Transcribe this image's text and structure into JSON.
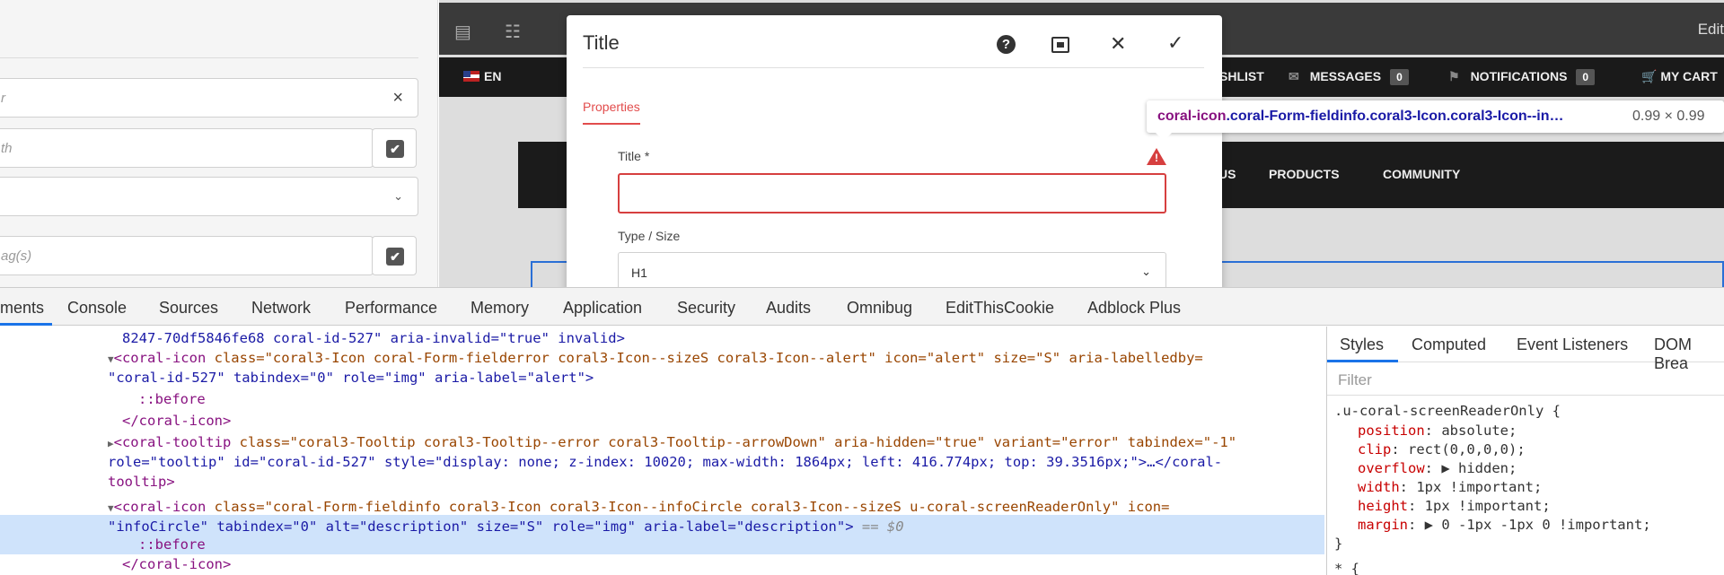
{
  "side_panel": {
    "field1_value": "r",
    "field2_placeholder": "th",
    "field4_placeholder": "ag(s)",
    "clear_symbol": "×",
    "check_symbol": "✔",
    "chevron_symbol": "⌄"
  },
  "editor": {
    "edit_label": "Edit"
  },
  "site_nav": {
    "language": "EN",
    "wishlist": "SHLIST",
    "messages": "MESSAGES",
    "messages_count": "0",
    "notifications": "NOTIFICATIONS",
    "notifications_count": "0",
    "cart": "MY CART"
  },
  "site_menu": {
    "items": [
      "US",
      "PRODUCTS",
      "COMMUNITY"
    ]
  },
  "dialog": {
    "title": "Title",
    "help_glyph": "?",
    "close_glyph": "✕",
    "confirm_glyph": "✓",
    "tab_properties": "Properties",
    "field_title_label": "Title *",
    "field_title_value": "",
    "alert_glyph": "!",
    "field_type_label": "Type / Size",
    "field_type_value": "H1",
    "chevron": "⌄"
  },
  "inspect_tooltip": {
    "tag": "coral-icon",
    "classes": ".coral-Form-fieldinfo.coral3-Icon.coral3-Icon--in…",
    "dimensions": "0.99 × 0.99"
  },
  "devtools": {
    "tabs": [
      "ments",
      "Console",
      "Sources",
      "Network",
      "Performance",
      "Memory",
      "Application",
      "Security",
      "Audits",
      "Omnibug",
      "EditThisCookie",
      "Adblock Plus"
    ],
    "active_tab": "ments",
    "styles_tabs": [
      "Styles",
      "Computed",
      "Event Listeners",
      "DOM Brea"
    ],
    "filter_placeholder": "Filter",
    "dom": {
      "l1": "8247-70df5846fe68 coral-id-527\" aria-invalid=\"true\" invalid>",
      "l2_tag": "<coral-icon",
      "l2_attrs": " class=\"coral3-Icon coral-Form-fielderror coral3-Icon--sizeS coral3-Icon--alert\" icon=\"alert\" size=\"S\" aria-labelledby=",
      "l3": "\"coral-id-527\" tabindex=\"0\" role=\"img\" aria-label=\"alert\">",
      "l4": "::before",
      "l5": "</coral-icon>",
      "l6_tag": "<coral-tooltip",
      "l6_attrs": " class=\"coral3-Tooltip coral3-Tooltip--error coral3-Tooltip--arrowDown\" aria-hidden=\"true\" variant=\"error\" tabindex=\"-1\"",
      "l7": "role=\"tooltip\" id=\"coral-id-527\" style=\"display: none; z-index: 10020; max-width: 1864px; left: 416.774px; top: 39.3516px;\">…</coral-",
      "l8": "tooltip>",
      "l9_tag": "<coral-icon",
      "l9_attrs": " class=\"coral-Form-fieldinfo coral3-Icon coral3-Icon--infoCircle coral3-Icon--sizeS u-coral-screenReaderOnly\" icon=",
      "l10": "\"infoCircle\" tabindex=\"0\" alt=\"description\" size=\"S\" role=\"img\" aria-label=\"description\">",
      "l10_eq": " == $0",
      "l11": "::before",
      "l12": "</coral-icon>"
    },
    "css": {
      "selector": ".u-coral-screenReaderOnly {",
      "rules": [
        {
          "prop": "position",
          "val": "absolute;",
          "struck": true
        },
        {
          "prop": "clip",
          "val": "rect(0,0,0,0);",
          "struck": false
        },
        {
          "prop": "overflow",
          "val": "▶ hidden;",
          "struck": false
        },
        {
          "prop": "width",
          "val": "1px !important;",
          "struck": false
        },
        {
          "prop": "height",
          "val": "1px !important;",
          "struck": false
        },
        {
          "prop": "margin",
          "val": "▶ 0 -1px -1px 0 !important;",
          "struck": false
        }
      ],
      "close": "}",
      "next": "* {"
    }
  }
}
